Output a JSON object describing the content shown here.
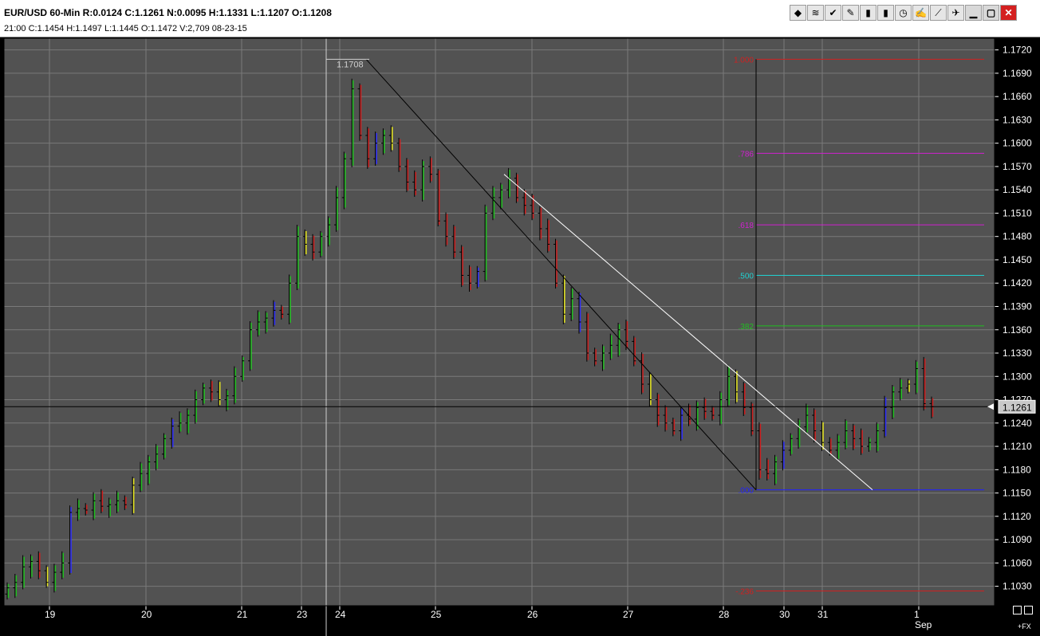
{
  "header": {
    "title_line": "EUR/USD  60-Min  R:0.0124  C:1.1261  N:0.0095  H:1.1331  L:1.1207  O:1.1208",
    "ohlc_line": "21:00  C:1.1454  H:1.1497  L:1.1445  O:1.1472  V:2,709  08-23-15"
  },
  "toolbar": {
    "icons": [
      "chart-type-icon",
      "wave-icon",
      "indicator-icon",
      "pencil-icon",
      "bars-icon",
      "candle-icon",
      "clock-icon",
      "notepad-icon",
      "drawing-tool-icon",
      "pin-icon",
      "minimize-icon",
      "restore-icon",
      "close-icon"
    ],
    "glyphs": [
      "◆",
      "≋",
      "✔",
      "✎",
      "▮",
      "▮",
      "◷",
      "✍",
      "⟋",
      "✈",
      "▁",
      "▢",
      "✕"
    ]
  },
  "chart_data": {
    "type": "bar",
    "instrument": "EUR/USD",
    "timeframe": "60-Min",
    "y_ticks": [
      "1.1720",
      "1.1690",
      "1.1660",
      "1.1630",
      "1.1600",
      "1.1570",
      "1.1540",
      "1.1510",
      "1.1480",
      "1.1450",
      "1.1420",
      "1.1390",
      "1.1360",
      "1.1330",
      "1.1300",
      "1.1270",
      "1.1240",
      "1.1210",
      "1.1180",
      "1.1150",
      "1.1120",
      "1.1090",
      "1.1060",
      "1.1030"
    ],
    "ylim": [
      1.1005,
      1.1735
    ],
    "x_labels": [
      "19",
      "20",
      "21",
      "23",
      "24",
      "25",
      "26",
      "27",
      "28",
      "30",
      "31",
      "1"
    ],
    "month_label": "Sep",
    "current_price": "1.1261",
    "cursor_price_label": "1.1708",
    "fib_levels": [
      {
        "label": "1.000",
        "price": 1.1708,
        "color": "#d02020"
      },
      {
        "label": ".786",
        "price": 1.1587,
        "color": "#d020d0"
      },
      {
        "label": ".618",
        "price": 1.1495,
        "color": "#d020d0"
      },
      {
        "label": ".500",
        "price": 1.143,
        "color": "#20d0d0"
      },
      {
        "label": ".382",
        "price": 1.1365,
        "color": "#20c020"
      },
      {
        "label": ".000",
        "price": 1.1154,
        "color": "#2020ff"
      },
      {
        "label": "-.236",
        "price": 1.1024,
        "color": "#d02020"
      }
    ],
    "grid": true,
    "series": [
      {
        "values": [
          1.1028,
          1.1035,
          1.1055,
          1.1062,
          1.105,
          1.1035,
          1.1048,
          1.106,
          1.1125,
          1.113,
          1.1128,
          1.114,
          1.1133,
          1.1135,
          1.114,
          1.1135,
          1.116,
          1.1175,
          1.119,
          1.12,
          1.122,
          1.1236,
          1.124,
          1.125,
          1.127,
          1.1285,
          1.128,
          1.127,
          1.1275,
          1.13,
          1.132,
          1.136,
          1.137,
          1.1375,
          1.1385,
          1.138,
          1.142,
          1.148,
          1.147,
          1.146,
          1.148,
          1.1495,
          1.153,
          1.158,
          1.167,
          1.161,
          1.158,
          1.16,
          1.161,
          1.16,
          1.157,
          1.155,
          1.154,
          1.157,
          1.156,
          1.15,
          1.148,
          1.146,
          1.143,
          1.142,
          1.1435,
          1.151,
          1.153,
          1.154,
          1.1555,
          1.153,
          1.152,
          1.151,
          1.149,
          1.147,
          1.142,
          1.138,
          1.14,
          1.137,
          1.133,
          1.132,
          1.133,
          1.134,
          1.136,
          1.1345,
          1.132,
          1.129,
          1.127,
          1.125,
          1.124,
          1.123,
          1.125,
          1.1245,
          1.126,
          1.1255,
          1.125,
          1.127,
          1.13,
          1.128,
          1.126,
          1.123,
          1.118,
          1.1175,
          1.119,
          1.1205,
          1.122,
          1.1235,
          1.125,
          1.123,
          1.1215,
          1.1205,
          1.1215,
          1.123,
          1.122,
          1.121,
          1.1215,
          1.123,
          1.126,
          1.128,
          1.1285,
          1.129,
          1.131,
          1.1265,
          1.1261
        ]
      }
    ]
  }
}
